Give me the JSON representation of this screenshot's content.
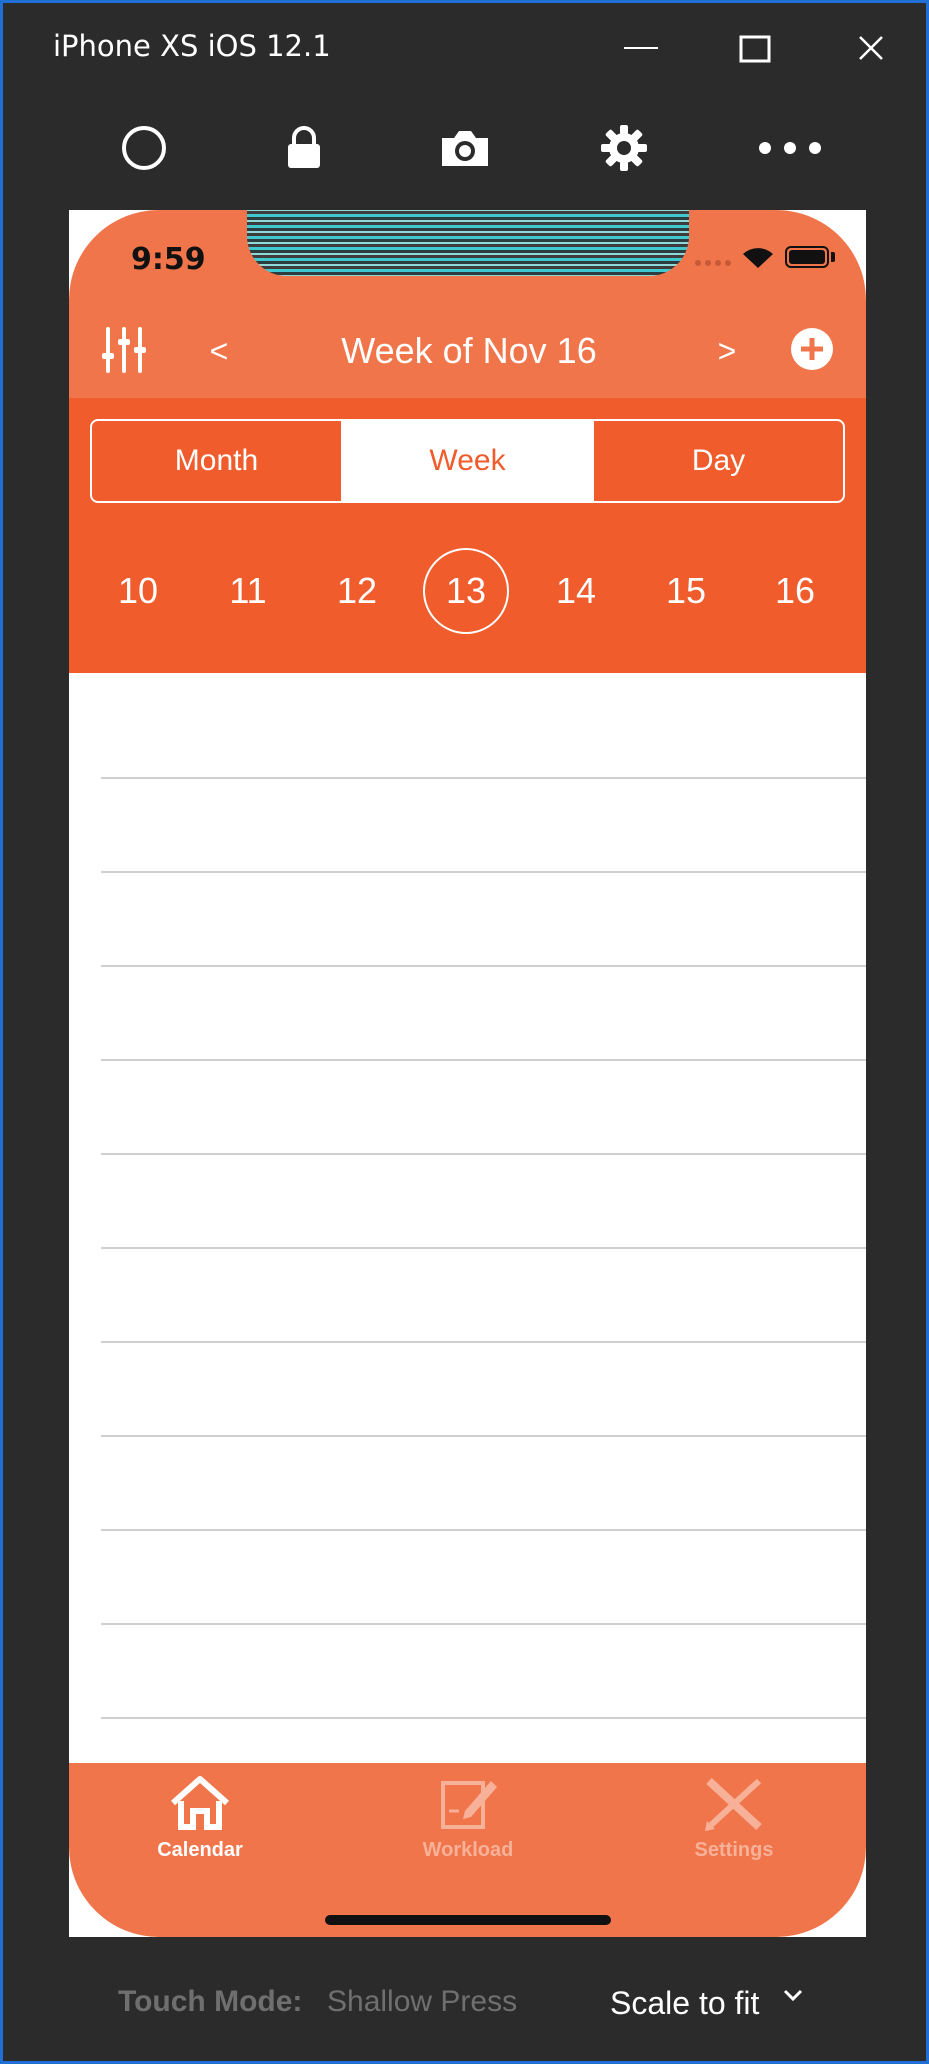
{
  "window": {
    "title": "iPhone XS iOS 12.1"
  },
  "toolbar": {
    "icons": [
      "home-circle-icon",
      "lock-icon",
      "camera-icon",
      "gear-icon",
      "more-icon"
    ]
  },
  "status_bar": {
    "time": "9:59"
  },
  "nav": {
    "title": "Week of Nov 16",
    "prev": "<",
    "next": ">"
  },
  "segments": [
    {
      "label": "Month",
      "active": false
    },
    {
      "label": "Week",
      "active": true
    },
    {
      "label": "Day",
      "active": false
    }
  ],
  "days": [
    "10",
    "11",
    "12",
    "13",
    "14",
    "15",
    "16"
  ],
  "selected_day": "13",
  "tabs": [
    {
      "label": "Calendar",
      "icon": "home-icon",
      "active": true
    },
    {
      "label": "Workload",
      "icon": "edit-icon",
      "active": false
    },
    {
      "label": "Settings",
      "icon": "tools-icon",
      "active": false
    }
  ],
  "footer": {
    "touch_mode_label": "Touch Mode:",
    "touch_mode_value": "Shallow Press",
    "scale": "Scale to fit"
  },
  "colors": {
    "accent": "#f05c2c",
    "header": "#f0754b",
    "frame": "#2b2b2b",
    "border": "#1f6fd6"
  }
}
